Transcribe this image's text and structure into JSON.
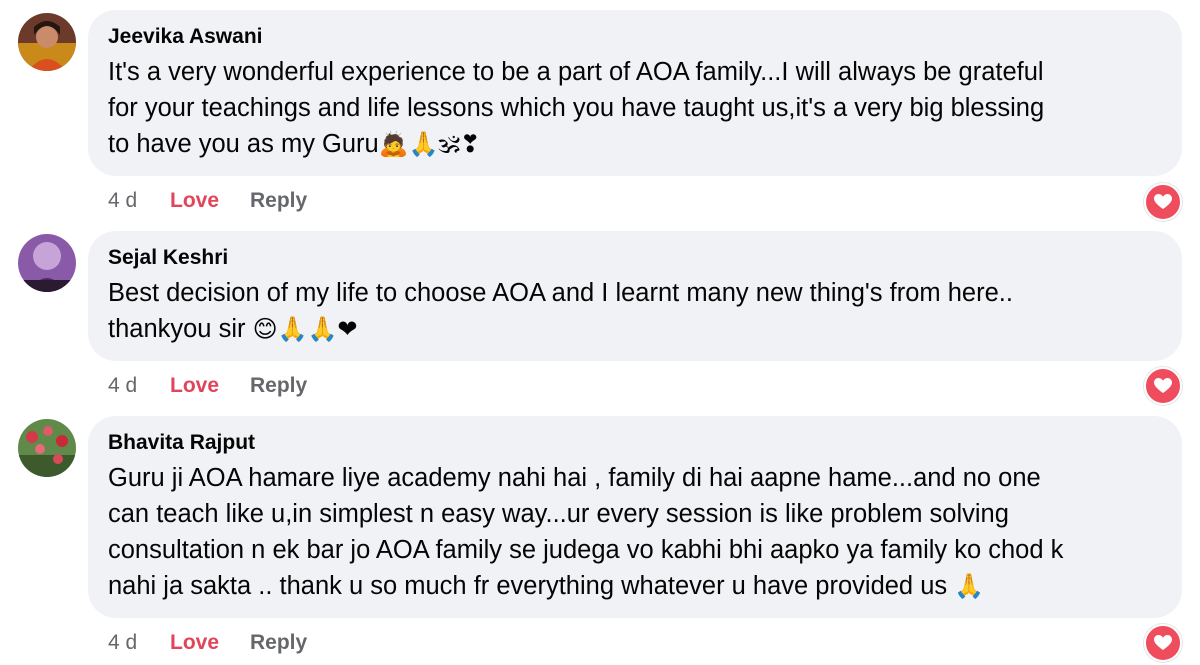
{
  "comments": [
    {
      "author": "Jeevika Aswani",
      "lines": [
        "It's a very wonderful experience to be a part of AOA family...I will always be grateful",
        "for your teachings and life lessons which you have taught us,it's a very big blessing",
        "to have you as my Guru"
      ],
      "emojis": "🙇🙏🕉❣",
      "time": "4 d",
      "love_label": "Love",
      "reply_label": "Reply",
      "reaction": "heart-reaction"
    },
    {
      "author": "Sejal Keshri",
      "lines": [
        "Best decision of my life to choose AOA and I learnt many new thing's from here..",
        "thankyou sir "
      ],
      "emojis": "😊🙏🙏❤",
      "time": "4 d",
      "love_label": "Love",
      "reply_label": "Reply",
      "reaction": "heart-reaction"
    },
    {
      "author": "Bhavita Rajput",
      "lines": [
        "Guru ji AOA hamare liye academy nahi hai , family di hai aapne hame...and no one",
        "can teach like u,in simplest n easy way...ur every session is like problem solving",
        "consultation n ek bar jo AOA family se judega vo kabhi bhi aapko ya family ko chod k",
        "nahi ja sakta .. thank u so much fr everything whatever u have provided us "
      ],
      "emojis": "🙏",
      "time": "4 d",
      "love_label": "Love",
      "reply_label": "Reply",
      "reaction": "heart-reaction"
    }
  ],
  "colors": {
    "bubble": "#f0f2f5",
    "love": "#e0455a",
    "meta": "#65676b",
    "reaction": "#ef4d5e"
  }
}
